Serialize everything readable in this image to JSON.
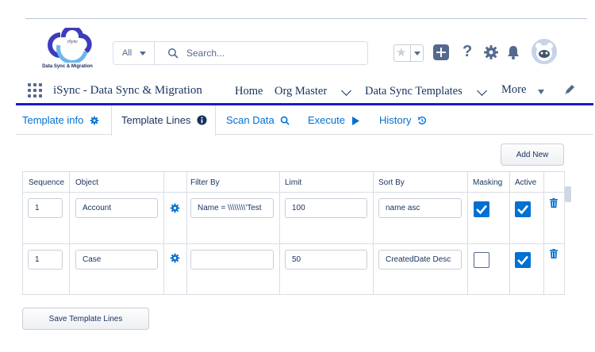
{
  "logo": {
    "text": "Data Sync & Migration",
    "inner_text": "iSync"
  },
  "search": {
    "scope": "All",
    "placeholder": "Search..."
  },
  "app": {
    "name": "iSync - Data Sync & Migration"
  },
  "nav": [
    {
      "label": "Home"
    },
    {
      "label": "Org Master"
    },
    {
      "label": "Data Sync Templates"
    },
    {
      "label": "More"
    }
  ],
  "tabs": [
    {
      "label": "Template info",
      "icon": "gear-icon"
    },
    {
      "label": "Template Lines",
      "icon": "info-icon"
    },
    {
      "label": "Scan Data",
      "icon": "search-icon"
    },
    {
      "label": "Execute",
      "icon": "play-icon"
    },
    {
      "label": "History",
      "icon": "history-icon"
    }
  ],
  "buttons": {
    "add_new": "Add New",
    "save": "Save Template Lines"
  },
  "columns": [
    "Sequence",
    "Object",
    "",
    "Filter By",
    "Limit",
    "Sort By",
    "Masking",
    "Active",
    ""
  ],
  "rows": [
    {
      "sequence": "1",
      "object": "Account",
      "filter": "Name = \\\\\\\\\\\\\\\\'Test",
      "limit": "100",
      "sort": "name asc",
      "masking": true,
      "active": true
    },
    {
      "sequence": "1",
      "object": "Case",
      "filter": "",
      "limit": "50",
      "sort": "CreatedDate Desc",
      "masking": false,
      "active": true
    }
  ],
  "colors": {
    "brand_blue": "#0070d2",
    "text_dark": "#16325c",
    "border": "#d8dde6",
    "nav_underline": "#1b1bc8"
  }
}
